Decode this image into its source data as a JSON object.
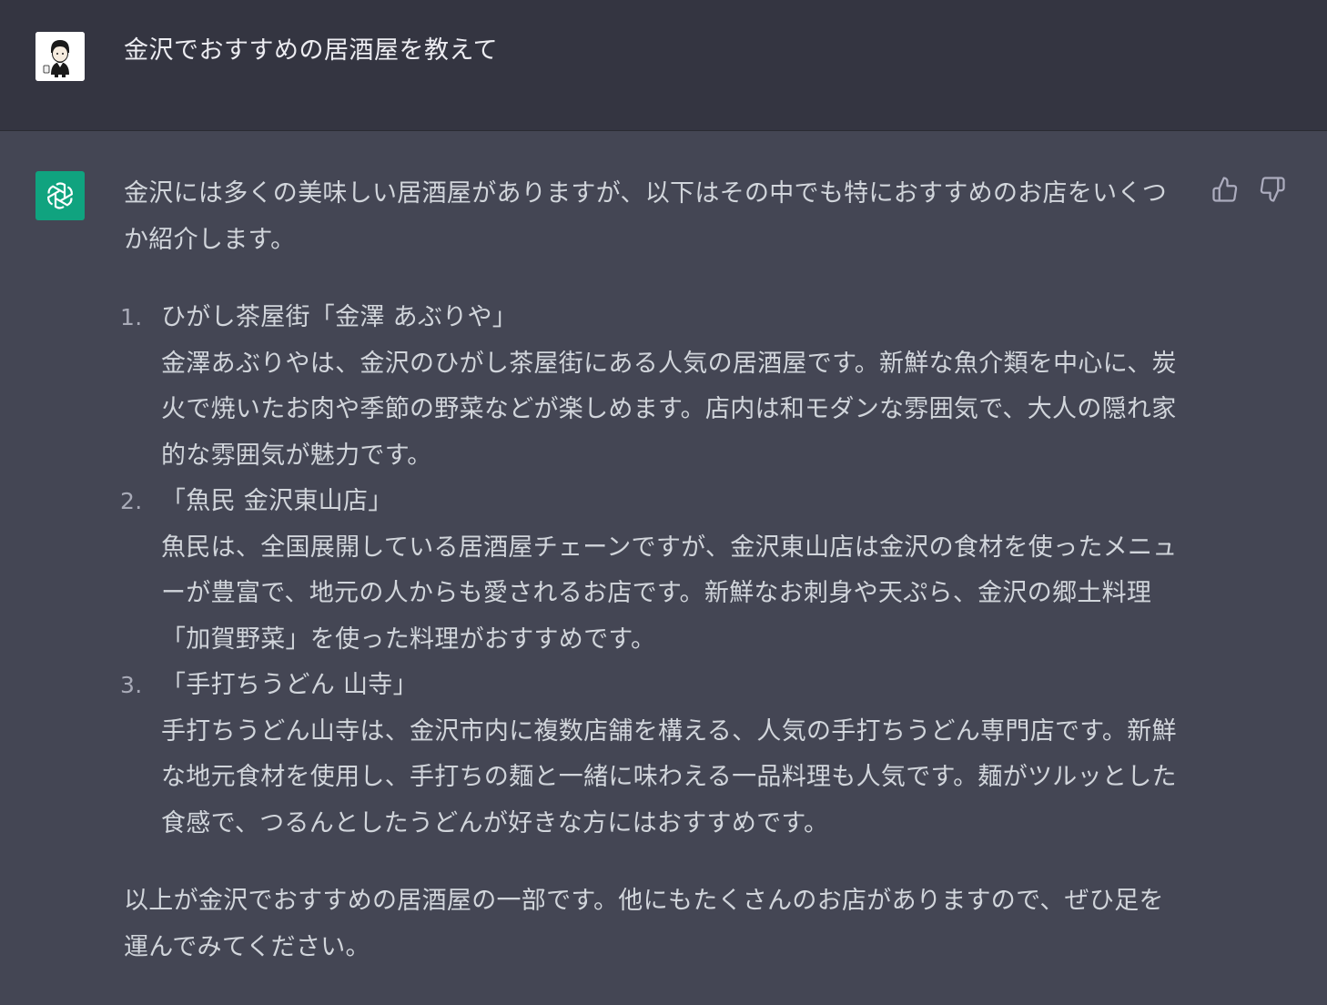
{
  "user_message": {
    "text": "金沢でおすすめの居酒屋を教えて",
    "avatar_icon": "user-avatar-icon"
  },
  "assistant_message": {
    "avatar_icon": "openai-logo-icon",
    "intro": "金沢には多くの美味しい居酒屋がありますが、以下はその中でも特におすすめのお店をいくつか紹介します。",
    "items": [
      {
        "number": "1.",
        "title": "ひがし茶屋街「金澤 あぶりや」",
        "description": "金澤あぶりやは、金沢のひがし茶屋街にある人気の居酒屋です。新鮮な魚介類を中心に、炭火で焼いたお肉や季節の野菜などが楽しめます。店内は和モダンな雰囲気で、大人の隠れ家的な雰囲気が魅力です。"
      },
      {
        "number": "2.",
        "title": "「魚民 金沢東山店」",
        "description": "魚民は、全国展開している居酒屋チェーンですが、金沢東山店は金沢の食材を使ったメニューが豊富で、地元の人からも愛されるお店です。新鮮なお刺身や天ぷら、金沢の郷土料理「加賀野菜」を使った料理がおすすめです。"
      },
      {
        "number": "3.",
        "title": "「手打ちうどん 山寺」",
        "description": "手打ちうどん山寺は、金沢市内に複数店舗を構える、人気の手打ちうどん専門店です。新鮮な地元食材を使用し、手打ちの麺と一緒に味わえる一品料理も人気です。麺がツルッとした食感で、つるんとしたうどんが好きな方にはおすすめです。"
      }
    ],
    "outro": "以上が金沢でおすすめの居酒屋の一部です。他にもたくさんのお店がありますので、ぜひ足を運んでみてください。"
  },
  "actions": {
    "thumbs_up_icon": "thumbs-up-icon",
    "thumbs_down_icon": "thumbs-down-icon"
  },
  "colors": {
    "user_bg": "#343541",
    "assistant_bg": "#444654",
    "bot_avatar_bg": "#10a37f",
    "text": "#d1d5db"
  }
}
